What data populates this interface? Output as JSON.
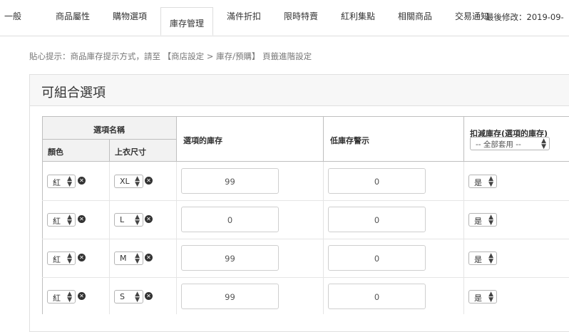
{
  "tabs": [
    {
      "label": "一般",
      "active": false
    },
    {
      "label": "商品屬性",
      "active": false
    },
    {
      "label": "購物選項",
      "active": false
    },
    {
      "label": "庫存管理",
      "active": true
    },
    {
      "label": "滿件折扣",
      "active": false
    },
    {
      "label": "限時特賣",
      "active": false
    },
    {
      "label": "紅利集點",
      "active": false
    },
    {
      "label": "相關商品",
      "active": false
    },
    {
      "label": "交易通知",
      "active": false
    }
  ],
  "last_modified": "最後修改：2019-09-",
  "tip": "貼心提示：商品庫存提示方式，請至 【商店設定 > 庫存/預購】 頁籤進階設定",
  "panel_title": "可組合選項",
  "table": {
    "group_header": "選項名稱",
    "col_color": "顏色",
    "col_size": "上衣尺寸",
    "col_stock": "選項的庫存",
    "col_low": "低庫存警示",
    "col_deduct": "扣減庫存(選項的庫存)",
    "apply_all": "-- 全部套用 --"
  },
  "rows": [
    {
      "color": "紅",
      "size": "XL",
      "stock": "99",
      "low": "0",
      "deduct": "是"
    },
    {
      "color": "紅",
      "size": "L",
      "stock": "0",
      "low": "0",
      "deduct": "是"
    },
    {
      "color": "紅",
      "size": "M",
      "stock": "99",
      "low": "0",
      "deduct": "是"
    },
    {
      "color": "紅",
      "size": "S",
      "stock": "99",
      "low": "0",
      "deduct": "是"
    }
  ]
}
